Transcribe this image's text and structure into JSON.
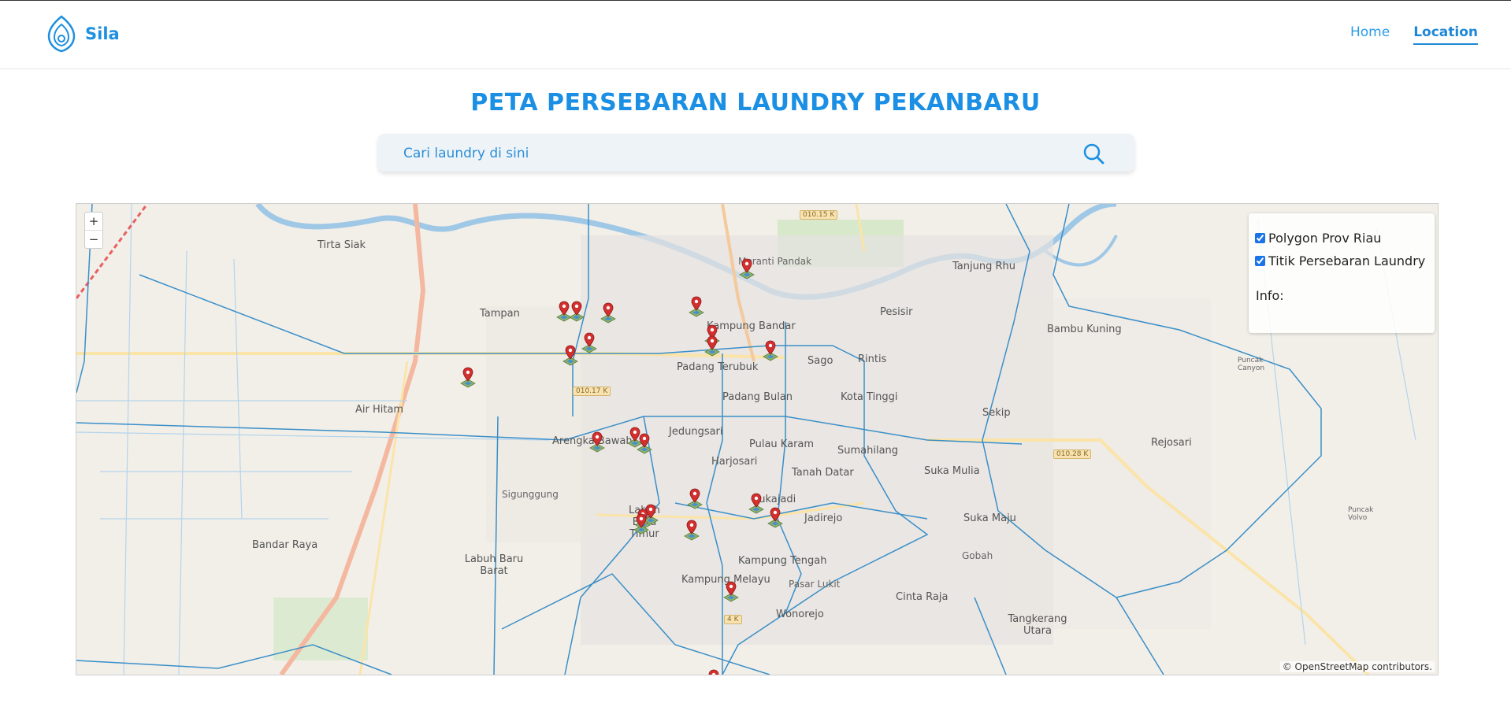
{
  "brand": {
    "name": "Sila",
    "logo_icon": "location-pin-icon"
  },
  "nav": {
    "home": "Home",
    "location": "Location"
  },
  "page_title": "PETA PERSEBARAN LAUNDRY PEKANBARU",
  "search": {
    "placeholder": "Cari laundry di sini",
    "value": "",
    "icon": "search-icon"
  },
  "map": {
    "zoom_in": "+",
    "zoom_out": "−",
    "layers": {
      "polygon_label": "Polygon Prov Riau",
      "polygon_checked": true,
      "points_label": "Titik Persebaran Laundry",
      "points_checked": true,
      "info_label": "Info:"
    },
    "attribution": "© OpenStreetMap contributors.",
    "place_labels": [
      "Tirta Siak",
      "Tampan",
      "Air Hitam",
      "Arengka Bawah",
      "Sigunggung",
      "Bandar Raya",
      "Labuh Baru Barat",
      "Labuh Baru Timur",
      "Padang Terubuk",
      "Kampung Bandar",
      "Sago",
      "Rintis",
      "Pesisir",
      "Tanjung Rhu",
      "Bambu Kuning",
      "Padang Bulan",
      "Kota Tinggi",
      "Sekip",
      "Jedungsari",
      "Pulau Karam",
      "Sumahilang",
      "Harjosari",
      "Tanah Datar",
      "Suka Mulia",
      "Rejosari",
      "Sukajadi",
      "Jadirejo",
      "Suka Maju",
      "Kampung Tengah",
      "Gobah",
      "Kampung Melayu",
      "Pasar Lukit",
      "Cinta Raja",
      "Wonorejo",
      "Tangkerang Utara",
      "Meranti Pandak",
      "Puncak Canyon",
      "Puncak Volvo"
    ],
    "road_badges": [
      "010.15 K",
      "010.17 K",
      "010.28 K",
      "4 K"
    ],
    "colors": {
      "polygon": "#3a8fc8",
      "marker": "#d32f2f",
      "accent": "#1a8fe3"
    }
  }
}
